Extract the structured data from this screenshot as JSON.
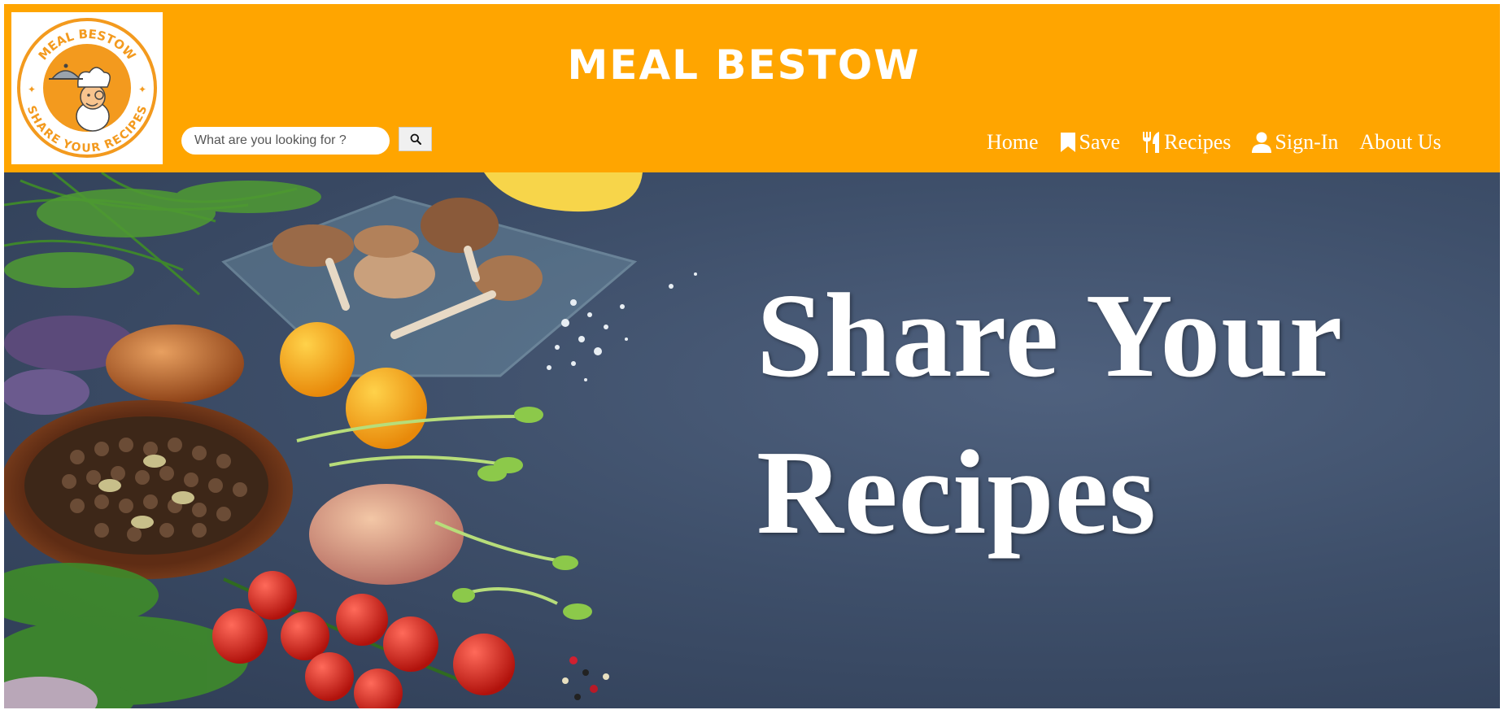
{
  "header": {
    "site_title": "MEAL BESTOW",
    "logo": {
      "top_text": "MEAL BESTOW",
      "bottom_text": "SHARE YOUR RECIPES",
      "icon": "chef-mascot-logo"
    }
  },
  "search": {
    "placeholder": "What are you looking for ?",
    "value": "",
    "button_icon": "search-icon"
  },
  "nav": {
    "items": [
      {
        "label": "Home",
        "icon": null
      },
      {
        "label": "Save",
        "icon": "bookmark-icon"
      },
      {
        "label": "Recipes",
        "icon": "utensils-icon"
      },
      {
        "label": "Sign-In",
        "icon": "user-icon"
      },
      {
        "label": "About Us",
        "icon": null
      }
    ]
  },
  "hero": {
    "line1": "Share Your",
    "line2": "Recipes",
    "image": "vegetables-and-spices-on-slate-background"
  },
  "colors": {
    "header_bg": "#ffa500",
    "header_text": "#ffffff",
    "hero_bg": "#3e4f6a"
  }
}
